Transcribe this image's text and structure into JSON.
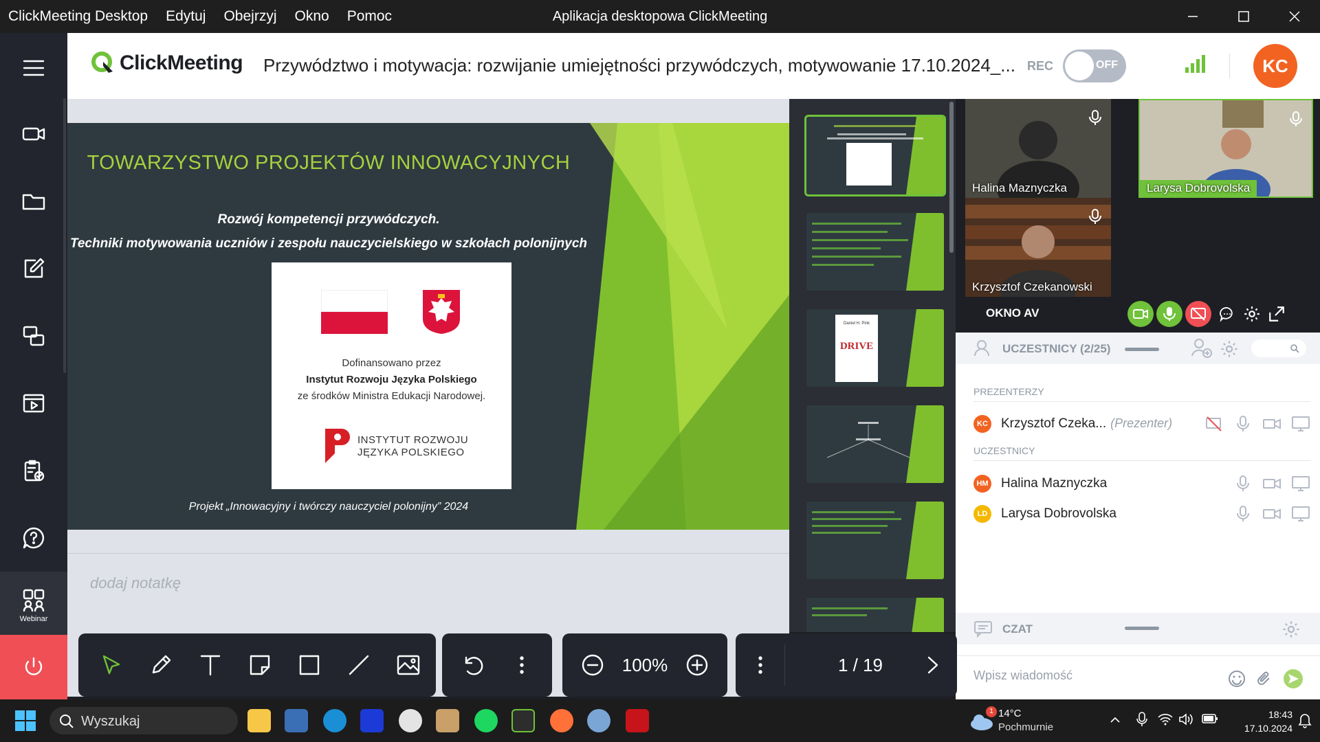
{
  "titlebar": {
    "menus": [
      "ClickMeeting Desktop",
      "Edytuj",
      "Obejrzyj",
      "Okno",
      "Pomoc"
    ],
    "window_title": "Aplikacja desktopowa ClickMeeting"
  },
  "header": {
    "logo": "ClickMeeting",
    "meeting_title": "Przywództwo i motywacja: rozwijanie umiejętności przywódczych, motywowanie 17.10.2024_...",
    "rec_label": "REC",
    "rec_state": "OFF",
    "user_initials": "KC",
    "accent": "#f26322"
  },
  "leftnav": {
    "webinar_label": "Webinar"
  },
  "slide": {
    "heading": "TOWARZYSTWO PROJEKTÓW INNOWACYJNYCH",
    "subtitle1": "Rozwój kompetencji przywódczych.",
    "subtitle2": "Techniki motywowania uczniów i zespołu nauczycielskiego w szkołach polonijnych",
    "card_line1": "Dofinansowano przez",
    "card_line2": "Instytut Rozwoju Języka Polskiego",
    "card_line3": "ze środków Ministra Edukacji Narodowej.",
    "institute_line1": "INSTYTUT ROZWOJU",
    "institute_line2": "JĘZYKA POLSKIEGO",
    "footer": "Projekt „Innowacyjny i twórczy nauczyciel polonijny” 2024",
    "thumb3_title": "DRIVE",
    "thumb3_author": "Daniel H. Pink"
  },
  "notes": {
    "placeholder": "dodaj notatkę"
  },
  "av": {
    "title": "OKNO AV",
    "participants_video": [
      "Halina Maznyczka",
      "Larysa Dobrovolska",
      "Krzysztof Czekanowski"
    ]
  },
  "participants": {
    "title": "UCZESTNICY (2/25)",
    "presenters_label": "PREZENTERZY",
    "attendees_label": "UCZESTNICY",
    "presenters": [
      {
        "initials": "KC",
        "name": "Krzysztof Czeka...",
        "role": "(Prezenter)",
        "color": "#f26322"
      }
    ],
    "attendees": [
      {
        "initials": "HM",
        "name": "Halina Maznyczka",
        "color": "#f26322"
      },
      {
        "initials": "LD",
        "name": "Larysa Dobrovolska",
        "color": "#f5b800"
      }
    ]
  },
  "chat": {
    "title": "CZAT",
    "placeholder": "Wpisz wiadomość"
  },
  "toolbar": {
    "zoom": "100%",
    "page": "1 / 19"
  },
  "taskbar": {
    "search": "Wyszukaj",
    "weather_temp": "14°C",
    "weather_desc": "Pochmurnie",
    "weather_badge": "1",
    "time": "18:43",
    "date": "17.10.2024"
  },
  "colors": {
    "green": "#6fc23a",
    "slide_bg": "#2e3a40",
    "power": "#ef4f55"
  }
}
